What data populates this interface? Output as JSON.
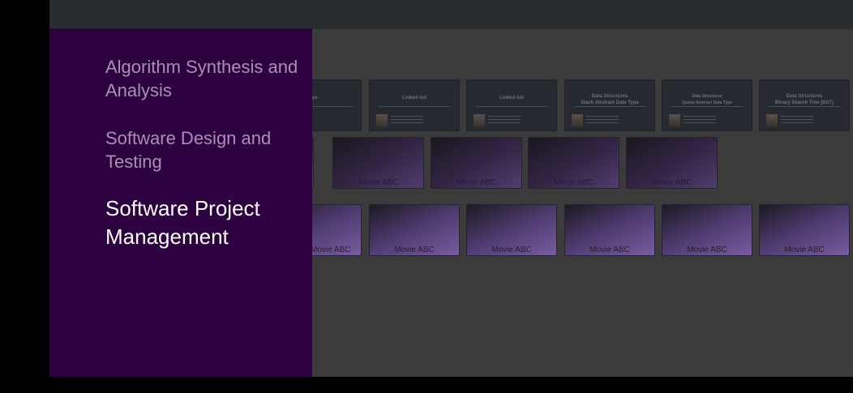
{
  "drawer": {
    "items": [
      {
        "label": "Algorithm Synthesis and Analysis",
        "selected": false
      },
      {
        "label": "Software Design and Testing",
        "selected": false
      },
      {
        "label": "Software Project Management",
        "selected": true
      }
    ]
  },
  "rows": {
    "lectures": [
      {
        "title": "rays"
      },
      {
        "title": "Linked list"
      },
      {
        "title": "Linked list"
      },
      {
        "title": "Data Structures\nStack Abstract Data Type"
      },
      {
        "title": "Data Structures\nQueue Abstract Data Type"
      },
      {
        "title": "Data Structures\nBinary Search Tree (BST)"
      }
    ],
    "posters_row2": [
      {
        "label": "Movie ABC"
      },
      {
        "label": "Movie ABC"
      },
      {
        "label": "Movie ABC"
      },
      {
        "label": "Movie ABC"
      }
    ],
    "posters_row3": [
      {
        "label": "Movie ABC"
      },
      {
        "label": "Movie ABC"
      },
      {
        "label": "Movie ABC"
      },
      {
        "label": "Movie ABC"
      },
      {
        "label": "Movie ABC"
      },
      {
        "label": "Movie ABC"
      }
    ]
  },
  "colors": {
    "drawer_bg": "#2d0040",
    "active_text": "#ffffff",
    "inactive_text": "#a892b4"
  }
}
